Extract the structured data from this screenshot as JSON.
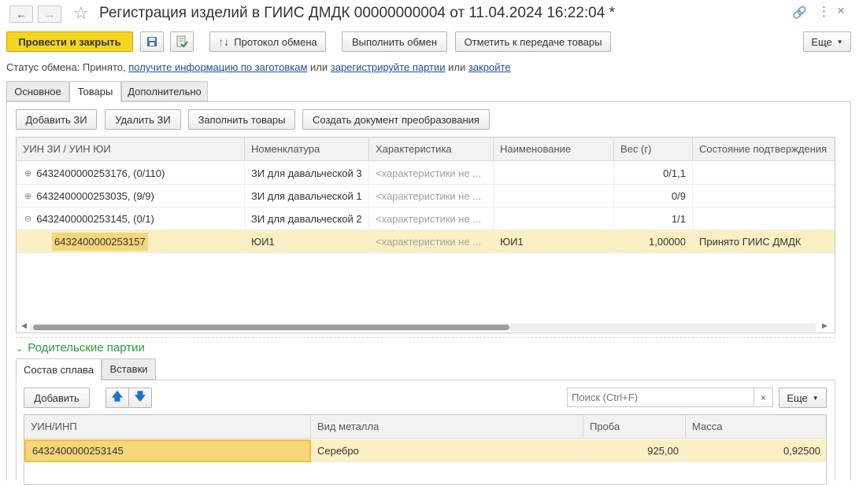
{
  "window": {
    "title": "Регистрация изделий в ГИИС ДМДК 00000000004 от 11.04.2024 16:22:04 *"
  },
  "toolbar": {
    "post_close": "Провести и закрыть",
    "exchange_protocol": "Протокол обмена",
    "do_exchange": "Выполнить обмен",
    "mark_transfer": "Отметить к передаче товары",
    "more": "Еще"
  },
  "status": {
    "prefix": "Статус обмена: Принято,",
    "link1": "получите информацию по заготовкам",
    "or1": "или",
    "link2": "зарегистрируйте партии",
    "or2": "или",
    "link3": "закройте"
  },
  "tabs": [
    {
      "label": "Основное"
    },
    {
      "label": "Товары"
    },
    {
      "label": "Дополнительно"
    }
  ],
  "goods_toolbar": {
    "add_zi": "Добавить ЗИ",
    "delete_zi": "Удалить ЗИ",
    "fill_goods": "Заполнить товары",
    "create_doc": "Создать документ преобразования"
  },
  "goods_table": {
    "columns": [
      "УИН ЗИ / УИН ЮИ",
      "Номенклатура",
      "Характеристика",
      "Наименование",
      "Вес (г)",
      "Состояние подтверждения"
    ],
    "rows": [
      {
        "tree": "⊕",
        "uin": "6432400000253176, (0/110)",
        "nom": "ЗИ для давальческой 3",
        "char": "<характеристики не ...",
        "name": "",
        "weight": "0/1,1",
        "state": ""
      },
      {
        "tree": "⊕",
        "uin": "6432400000253035, (9/9)",
        "nom": "ЗИ для давальческой 1",
        "char": "<характеристики не ...",
        "name": "",
        "weight": "0/9",
        "state": ""
      },
      {
        "tree": "⊖",
        "uin": "6432400000253145, (0/1)",
        "nom": "ЗИ для давальческой 2",
        "char": "<характеристики не ...",
        "name": "",
        "weight": "1/1",
        "state": ""
      },
      {
        "tree": "",
        "uin": "6432400000253157",
        "nom": "ЮИ1",
        "char": "<характеристики не ...",
        "name": "ЮИ1",
        "weight": "1,00000",
        "state": "Принято ГИИС ДМДК"
      }
    ]
  },
  "parent_section": {
    "title": "Родительские партии"
  },
  "sub_tabs": [
    {
      "label": "Состав сплава"
    },
    {
      "label": "Вставки"
    }
  ],
  "alloy_toolbar": {
    "add": "Добавить",
    "search_placeholder": "Поиск (Ctrl+F)",
    "more": "Еще"
  },
  "alloy_table": {
    "columns": [
      "УИН/ИНП",
      "Вид металла",
      "Проба",
      "Масса"
    ],
    "rows": [
      {
        "uin": "6432400000253145",
        "metal": "Серебро",
        "probe": "925,00",
        "mass": "0,92500"
      }
    ]
  },
  "colors": {
    "primary_button": "#f5d51f",
    "link": "#1a4fa6",
    "section_title": "#2e9a3e",
    "selected_row": "#fbf0c4"
  }
}
